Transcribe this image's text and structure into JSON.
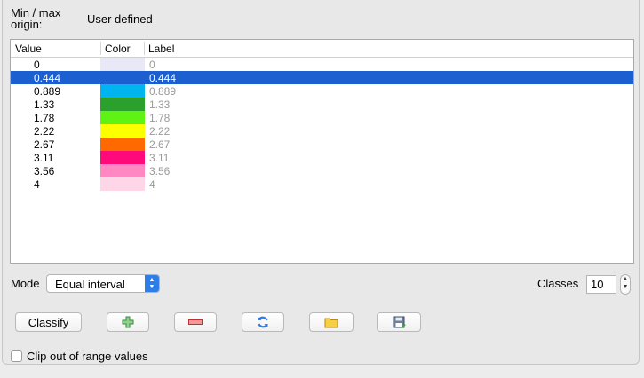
{
  "origin": {
    "label": "Min / max\norigin:",
    "value": "User defined"
  },
  "table": {
    "headers": {
      "value": "Value",
      "color": "Color",
      "label": "Label"
    },
    "rows": [
      {
        "value": "0",
        "color": "#e8e8f7",
        "label": "0"
      },
      {
        "value": "0.444",
        "color": "#1b5fd1",
        "label": "0.444"
      },
      {
        "value": "0.889",
        "color": "#00b4f0",
        "label": "0.889"
      },
      {
        "value": "1.33",
        "color": "#2ca02c",
        "label": "1.33"
      },
      {
        "value": "1.78",
        "color": "#5ff314",
        "label": "1.78"
      },
      {
        "value": "2.22",
        "color": "#fbff00",
        "label": "2.22"
      },
      {
        "value": "2.67",
        "color": "#ff6a00",
        "label": "2.67"
      },
      {
        "value": "3.11",
        "color": "#ff0a7a",
        "label": "3.11"
      },
      {
        "value": "3.56",
        "color": "#ff88c2",
        "label": "3.56"
      },
      {
        "value": "4",
        "color": "#ffd6e8",
        "label": "4"
      }
    ],
    "selected_index": 1
  },
  "mode": {
    "label": "Mode",
    "value": "Equal interval"
  },
  "classes": {
    "label": "Classes",
    "value": "10"
  },
  "buttons": {
    "classify": "Classify"
  },
  "icons": {
    "add": "add-icon",
    "remove": "remove-icon",
    "refresh": "refresh-icon",
    "open": "folder-icon",
    "save": "save-icon"
  },
  "clip": {
    "label": "Clip out of range values"
  }
}
